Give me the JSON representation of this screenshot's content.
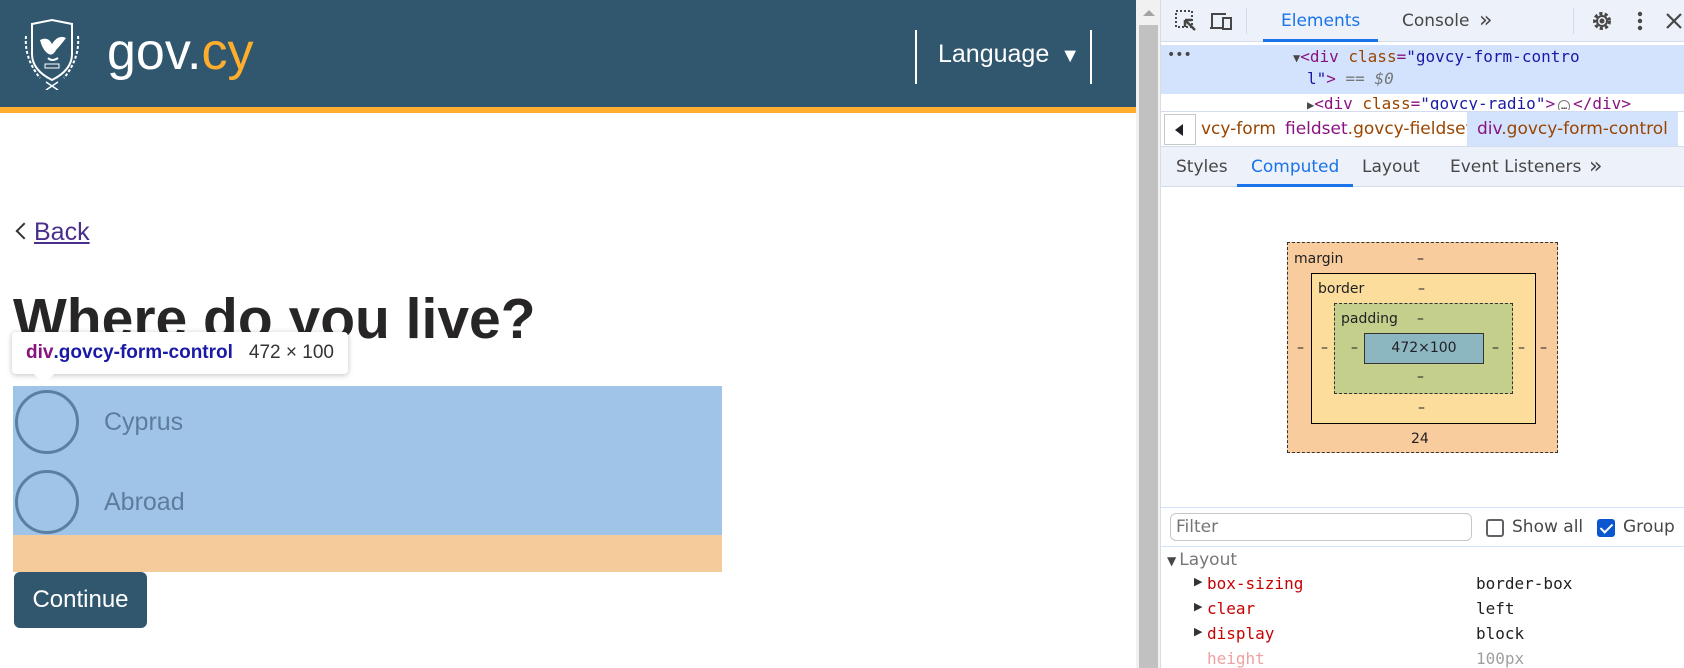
{
  "page": {
    "brand": {
      "prefix": "gov.",
      "suffix": "cy"
    },
    "language_button": "Language",
    "language_caret": "▼",
    "back_link": "Back",
    "heading": "Where do you live?",
    "radio_options": [
      {
        "label": "Cyprus",
        "selected": false
      },
      {
        "label": "Abroad",
        "selected": false
      }
    ],
    "continue_button": "Continue",
    "colors": {
      "header": "#31576f",
      "accent": "#ffad2d"
    }
  },
  "inspect_tooltip": {
    "tag": "div",
    "class": ".govcy-form-control",
    "dimensions": "472 × 100"
  },
  "devtools": {
    "main_tabs": [
      {
        "label": "Elements",
        "active": true
      },
      {
        "label": "Console",
        "active": false
      }
    ],
    "more_tabs": "»",
    "dom": {
      "dots": "•••",
      "selected_line_1": {
        "open": "<div",
        "attr": "class",
        "eq": "=",
        "value": "\"govcy-form-contro"
      },
      "selected_line_2": {
        "value": "l\"",
        "close": ">",
        "marker": "== $0"
      },
      "next_line": {
        "open": "<div",
        "attr": "class",
        "eq": "=",
        "value": "\"govcy-radio\"",
        "close": ">",
        "ellipsis": "…",
        "end": "</div>"
      }
    },
    "breadcrumbs": [
      {
        "tag": "",
        "cls": "vcy-form",
        "selected": false
      },
      {
        "tag": "fieldset",
        "cls": ".govcy-fieldset",
        "selected": false
      },
      {
        "tag": "div",
        "cls": ".govcy-form-control",
        "selected": true
      }
    ],
    "sub_tabs": [
      {
        "label": "Styles",
        "active": false
      },
      {
        "label": "Computed",
        "active": true
      },
      {
        "label": "Layout",
        "active": false
      },
      {
        "label": "Event Listeners",
        "active": false
      }
    ],
    "box_model": {
      "margin_label": "margin",
      "border_label": "border",
      "padding_label": "padding",
      "content": "472×100",
      "margin": {
        "top": "–",
        "right": "–",
        "bottom": "24",
        "left": "–"
      },
      "border": {
        "top": "–",
        "right": "–",
        "bottom": "–",
        "left": "–"
      },
      "padding": {
        "top": "–",
        "right": "–",
        "bottom": "–",
        "left": "–"
      }
    },
    "filter_placeholder": "Filter",
    "show_all": {
      "label": "Show all",
      "checked": false
    },
    "group": {
      "label": "Group",
      "checked": true
    },
    "section": "Layout",
    "properties": [
      {
        "name": "box-sizing",
        "value": "border-box",
        "dim": false
      },
      {
        "name": "clear",
        "value": "left",
        "dim": false
      },
      {
        "name": "display",
        "value": "block",
        "dim": false
      },
      {
        "name": "height",
        "value": "100px",
        "dim": true
      }
    ]
  }
}
